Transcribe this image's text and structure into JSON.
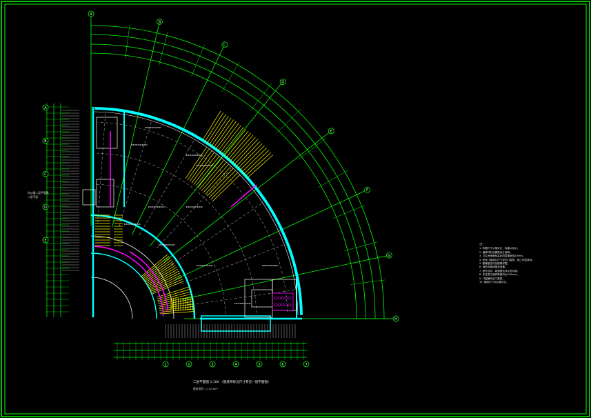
{
  "drawing": {
    "title_cn": "二层平面图",
    "scale": "1:100",
    "subtitle": "（图纸所标注尺寸参见一层平面图）",
    "area_line": "建筑面积: 1242.6m²",
    "side_note_1": "办公楼二层平面图",
    "side_note_2": "二层平面"
  },
  "grid_axes": {
    "radial": [
      "A",
      "B",
      "C",
      "D",
      "E",
      "F",
      "G",
      "H"
    ],
    "left": [
      "A",
      "B",
      "C",
      "D",
      "E"
    ],
    "bottom": [
      "1",
      "2",
      "3",
      "4",
      "5",
      "6",
      "7"
    ]
  },
  "notes": {
    "heading": "注：",
    "lines": [
      "1. 本图尺寸以毫米计，标高以米计。",
      "2. 墙体材料见建筑设计说明。",
      "3. 卫生间地面标高比同层楼面低20mm。",
      "4. 所有门窗洞口尺寸详见门窗表，施工时应核对。",
      "5. 楼梯做法详见楼梯详图。",
      "6. 消防设施按规范设置。",
      "7. 室外台阶、坡道做法详见总平面。",
      "8. 未注明之墙体厚度均为240mm。",
      "9. 门窗编号见门窗表。",
      "10. 轴线尺寸均以墙中计。"
    ]
  },
  "colors": {
    "frame": "#00ff00",
    "wall": "#00ffff",
    "axis": "#00ff00",
    "stair": "#ffff00",
    "accent": "#ff00ff",
    "grid_dash": "#b0b0b0",
    "text": "#e8e8e8"
  }
}
